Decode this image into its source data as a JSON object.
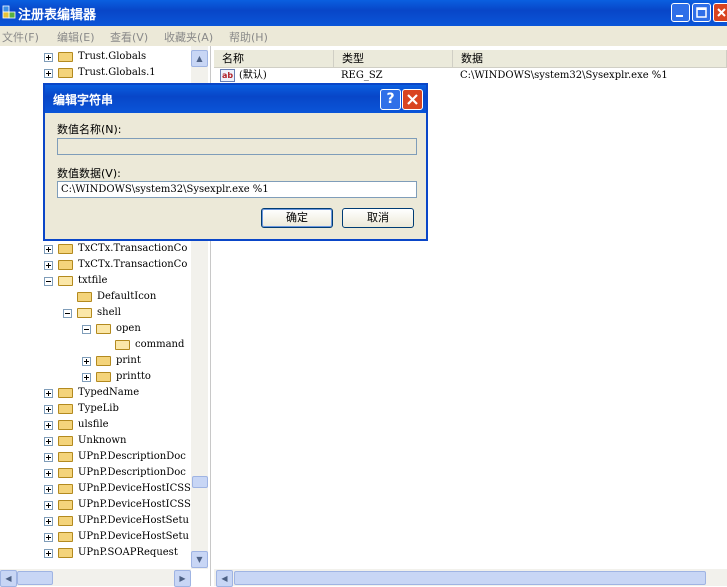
{
  "window": {
    "title": "注册表编辑器"
  },
  "menu": [
    "文件(F)",
    "编辑(E)",
    "查看(V)",
    "收藏夹(A)",
    "帮助(H)"
  ],
  "tree": {
    "top_items": [
      {
        "label": "Trust.Globals",
        "expander": "plus"
      },
      {
        "label": "Trust.Globals.1",
        "expander": "plus"
      }
    ],
    "items": [
      {
        "label": "TxCTx.TransactionCo",
        "level": 0,
        "expander": "plus"
      },
      {
        "label": "TxCTx.TransactionCo",
        "level": 0,
        "expander": "plus"
      },
      {
        "label": "txtfile",
        "level": 0,
        "expander": "minus",
        "open": true
      },
      {
        "label": "DefaultIcon",
        "level": 1,
        "expander": "none"
      },
      {
        "label": "shell",
        "level": 1,
        "expander": "minus",
        "open": true
      },
      {
        "label": "open",
        "level": 2,
        "expander": "minus",
        "open": true
      },
      {
        "label": "command",
        "level": 3,
        "expander": "none",
        "open": true
      },
      {
        "label": "print",
        "level": 2,
        "expander": "plus"
      },
      {
        "label": "printto",
        "level": 2,
        "expander": "plus"
      },
      {
        "label": "TypedName",
        "level": 0,
        "expander": "plus"
      },
      {
        "label": "TypeLib",
        "level": 0,
        "expander": "plus"
      },
      {
        "label": "ulsfile",
        "level": 0,
        "expander": "plus"
      },
      {
        "label": "Unknown",
        "level": 0,
        "expander": "plus"
      },
      {
        "label": "UPnP.DescriptionDoc",
        "level": 0,
        "expander": "plus"
      },
      {
        "label": "UPnP.DescriptionDoc",
        "level": 0,
        "expander": "plus"
      },
      {
        "label": "UPnP.DeviceHostICSS",
        "level": 0,
        "expander": "plus"
      },
      {
        "label": "UPnP.DeviceHostICSS",
        "level": 0,
        "expander": "plus"
      },
      {
        "label": "UPnP.DeviceHostSetu",
        "level": 0,
        "expander": "plus"
      },
      {
        "label": "UPnP.DeviceHostSetu",
        "level": 0,
        "expander": "plus"
      },
      {
        "label": "UPnP.SOAPRequest",
        "level": 0,
        "expander": "plus"
      }
    ]
  },
  "list": {
    "headers": [
      "名称",
      "类型",
      "数据"
    ],
    "rows": [
      {
        "name": "(默认)",
        "type": "REG_SZ",
        "data": "C:\\WINDOWS\\system32\\Sysexplr.exe %1"
      }
    ]
  },
  "dialog": {
    "title": "编辑字符串",
    "name_label": "数值名称(N):",
    "name_value": "",
    "data_label": "数值数据(V):",
    "data_value": "C:\\WINDOWS\\system32\\Sysexplr.exe %1",
    "ok": "确定",
    "cancel": "取消"
  },
  "icons": {
    "value_icon": "ab"
  }
}
